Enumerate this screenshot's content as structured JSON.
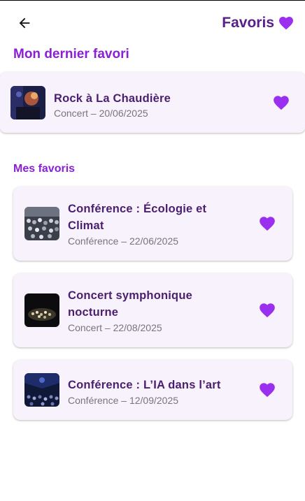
{
  "header": {
    "title": "Favoris",
    "back_icon": "arrow-left-icon",
    "heart_icon": "heart-icon"
  },
  "colors": {
    "accent": "#8a1fd6",
    "title_text": "#5a1e8c",
    "card_bg": "#f8f2fc",
    "heart": "#9b2ff0"
  },
  "latest": {
    "section_label": "Mon dernier favori",
    "item": {
      "title": "Rock à La Chaudière",
      "subtitle": "Concert – 20/06/2025"
    }
  },
  "favorites": {
    "section_label": "Mes favoris",
    "items": [
      {
        "title": "Conférence : Écologie et Climat",
        "subtitle": "Conférence – 22/06/2025"
      },
      {
        "title": "Concert symphonique nocturne",
        "subtitle": "Concert – 22/08/2025"
      },
      {
        "title": "Conférence : L’IA dans l’art",
        "subtitle": "Conférence – 12/09/2025"
      }
    ]
  }
}
